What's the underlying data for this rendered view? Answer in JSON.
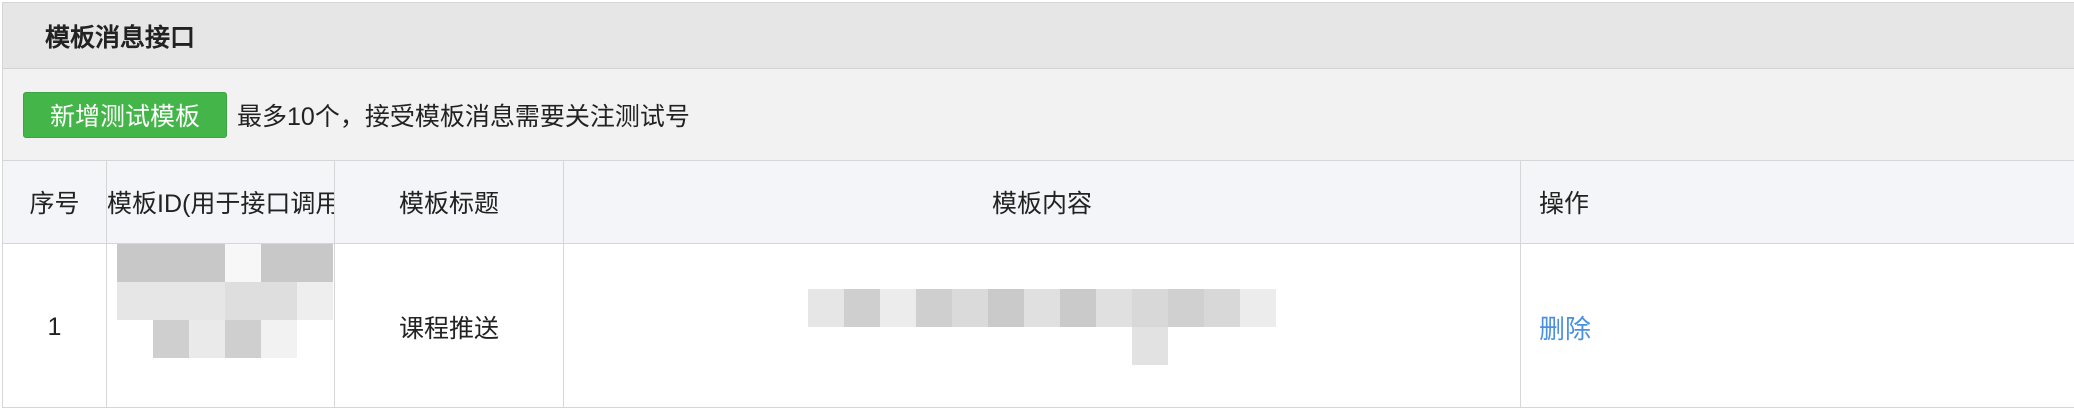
{
  "panel": {
    "title": "模板消息接口"
  },
  "toolbar": {
    "add_button_label": "新增测试模板",
    "hint": "最多10个，接受模板消息需要关注测试号"
  },
  "table": {
    "headers": {
      "index": "序号",
      "template_id": "模板ID(用于接口调用)",
      "title": "模板标题",
      "content": "模板内容",
      "action": "操作"
    },
    "rows": [
      {
        "index": "1",
        "title": "课程推送",
        "action": "删除"
      }
    ]
  },
  "colors": {
    "primary_button": "#44b549",
    "link": "#4a90e2",
    "header_bg": "#e6e6e6",
    "toolbar_bg": "#f2f2f2",
    "table_head_bg": "#f4f5f9"
  },
  "mosaic": {
    "id_cells": [
      "#c8c8c8",
      "#c8c8c8",
      "#c8c8c8",
      "#f7f7f7",
      "#c8c8c8",
      "#c8c8c8",
      "#e6e6e6",
      "#e6e6e6",
      "#e6e6e6",
      "#dedede",
      "#dedede",
      "#eeeeee",
      "#ffffff",
      "#cfcfcf",
      "#eaeaea",
      "#cfcfcf",
      "#f2f2f2",
      "#ffffff"
    ],
    "content_cells": [
      "#e6e6e6",
      "#cfcfcf",
      "#ececec",
      "#cfcfcf",
      "#dadada",
      "#cacaca",
      "#e0e0e0",
      "#cacaca",
      "#e0e0e0",
      "#d8d8d8",
      "#d0d0d0",
      "#d8d8d8",
      "#ececec",
      "#ffffff",
      "#ffffff",
      "#ffffff",
      "#ffffff",
      "#ffffff",
      "#ffffff",
      "#ffffff",
      "#ffffff",
      "#ffffff",
      "#e2e2e2",
      "#ffffff",
      "#ffffff",
      "#ffffff"
    ]
  }
}
